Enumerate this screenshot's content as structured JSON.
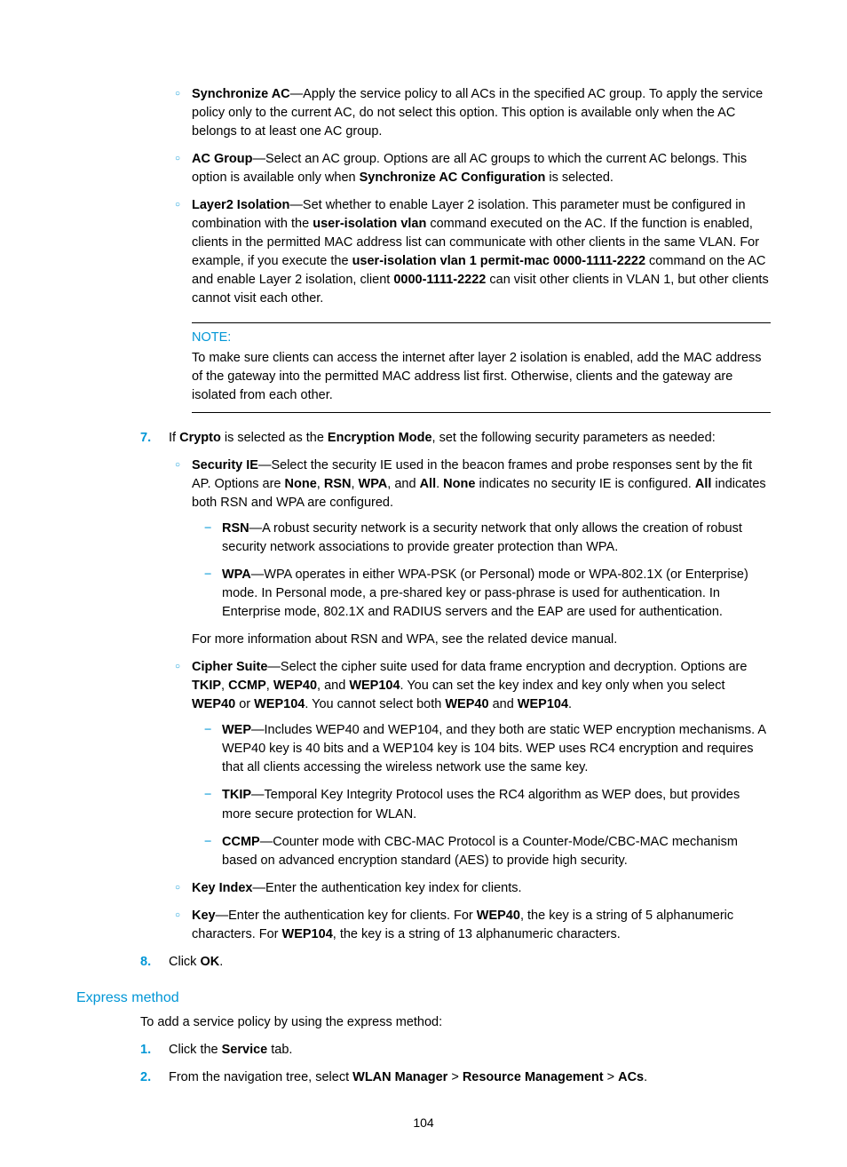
{
  "topBullets": {
    "syncAC": {
      "label": "Synchronize AC",
      "text": "—Apply the service policy to all ACs in the specified AC group. To apply the service policy only to the current AC, do not select this option. This option is available only when the AC belongs to at least one AC group."
    },
    "acGroup": {
      "label": "AC Group",
      "pre": "—Select an AC group. Options are all AC groups to which the current AC belongs. This option is available only when ",
      "bold1": "Synchronize AC Configuration",
      "post": " is selected."
    },
    "layer2": {
      "label": "Layer2 Isolation",
      "pre": "—Set whether to enable Layer 2 isolation. This parameter must be configured in combination with the ",
      "bold1": "user-isolation vlan",
      "mid1": " command executed on the AC. If the function is enabled, clients in the permitted MAC address list can communicate with other clients in the same VLAN. For example, if you execute the ",
      "bold2": "user-isolation vlan 1 permit-mac 0000-1111-2222",
      "mid2": " command on the AC and enable Layer 2 isolation, client ",
      "bold3": "0000-1111-2222",
      "post": " can visit other clients in VLAN 1, but other clients cannot visit each other."
    }
  },
  "note": {
    "title": "NOTE:",
    "body": "To make sure clients can access the internet after layer 2 isolation is enabled, add the MAC address of the gateway into the permitted MAC address list first. Otherwise, clients and the gateway are isolated from each other."
  },
  "step7": {
    "num": "7.",
    "pre": "If ",
    "b1": "Crypto",
    "mid": " is selected as the ",
    "b2": "Encryption Mode",
    "post": ", set the following security parameters as needed:"
  },
  "secIE": {
    "label": "Security IE",
    "pre": "—Select the security IE used in the beacon frames and probe responses sent by the fit AP. Options are ",
    "b1": "None",
    "c1": ", ",
    "b2": "RSN",
    "c2": ", ",
    "b3": "WPA",
    "c3": ", and ",
    "b4": "All",
    "c4": ". ",
    "b5": "None",
    "mid1": " indicates no security IE is configured. ",
    "b6": "All",
    "post": " indicates both RSN and WPA are configured."
  },
  "rsn": {
    "label": "RSN",
    "text": "—A robust security network is a security network that only allows the creation of robust security network associations to provide greater protection than WPA."
  },
  "wpa": {
    "label": "WPA",
    "text": "—WPA operates in either WPA-PSK (or Personal) mode or WPA-802.1X (or Enterprise) mode. In Personal mode, a pre-shared key or pass-phrase is used for authentication. In Enterprise mode, 802.1X and RADIUS servers and the EAP are used for authentication."
  },
  "moreInfo": "For more information about RSN and WPA, see the related device manual.",
  "cipher": {
    "label": "Cipher Suite",
    "pre": "—Select the cipher suite used for data frame encryption and decryption. Options are ",
    "b1": "TKIP",
    "c1": ", ",
    "b2": "CCMP",
    "c2": ", ",
    "b3": "WEP40",
    "c3": ", and ",
    "b4": "WEP104",
    "mid1": ". You can set the key index and key only when you select ",
    "b5": "WEP40",
    "c5": " or ",
    "b6": "WEP104",
    "mid2": ". You cannot select both ",
    "b7": "WEP40",
    "c7": " and ",
    "b8": "WEP104",
    "post": "."
  },
  "wep": {
    "label": "WEP",
    "text": "—Includes WEP40 and WEP104, and they both are static WEP encryption mechanisms. A WEP40 key is 40 bits and a WEP104 key is 104 bits. WEP uses RC4 encryption and requires that all clients accessing the wireless network use the same key."
  },
  "tkip": {
    "label": "TKIP",
    "text": "—Temporal Key Integrity Protocol uses the RC4 algorithm as WEP does, but provides more secure protection for WLAN."
  },
  "ccmp": {
    "label": "CCMP",
    "text": "—Counter mode with CBC-MAC Protocol is a Counter-Mode/CBC-MAC mechanism based on advanced encryption standard (AES) to provide high security."
  },
  "keyIndex": {
    "label": "Key Index",
    "text": "—Enter the authentication key index for clients."
  },
  "key": {
    "label": "Key",
    "pre": "—Enter the authentication key for clients. For ",
    "b1": "WEP40",
    "mid": ", the key is a string of 5 alphanumeric characters. For ",
    "b2": "WEP104",
    "post": ", the key is a string of 13 alphanumeric characters."
  },
  "step8": {
    "num": "8.",
    "pre": "Click ",
    "b1": "OK",
    "post": "."
  },
  "expressHeading": "Express method",
  "expressIntro": "To add a service policy by using the express method:",
  "exp1": {
    "num": "1.",
    "pre": "Click the ",
    "b1": "Service",
    "post": " tab."
  },
  "exp2": {
    "num": "2.",
    "pre": "From the navigation tree, select ",
    "b1": "WLAN Manager",
    "c1": " > ",
    "b2": "Resource Management",
    "c2": " > ",
    "b3": "ACs",
    "post": "."
  },
  "pageNum": "104"
}
